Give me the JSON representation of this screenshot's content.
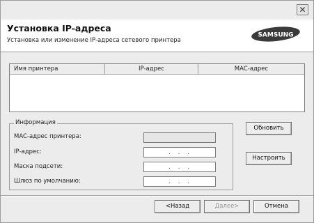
{
  "header": {
    "title": "Установка IP-адреса",
    "subtitle": "Установка или изменение IP-адреса сетевого принтера",
    "logo_text": "SAMSUNG"
  },
  "printer_list": {
    "columns": [
      "Имя принтера",
      "IP-адрес",
      "MAC-адрес"
    ],
    "rows": []
  },
  "info": {
    "legend": "Информация",
    "mac_label": "MAC-адрес принтера:",
    "mac_value": "",
    "ip_label": "IP-адрес:",
    "ip_value": ".    .    .",
    "mask_label": "Маска подсети:",
    "mask_value": ".    .    .",
    "gateway_label": "Шлюз по умолчанию:",
    "gateway_value": ".    .    ."
  },
  "buttons": {
    "refresh": "Обновить",
    "configure": "Настроить",
    "back": "<Назад",
    "next": "Далее>",
    "cancel": "Отмена"
  },
  "colors": {
    "window_bg": "#ececec",
    "header_bg": "#ffffff",
    "logo_fill": "#3a3a3a"
  },
  "icons": {
    "close": "close-icon"
  }
}
